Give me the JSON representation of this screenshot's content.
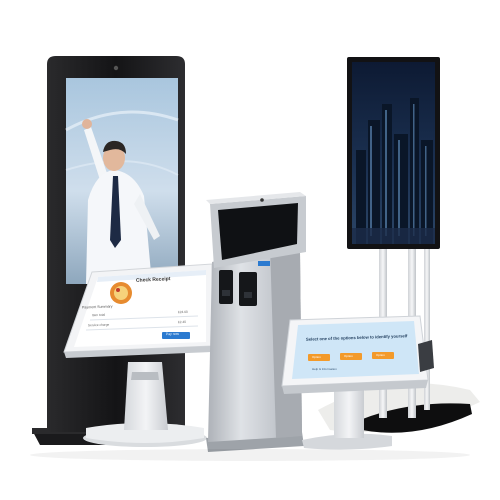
{
  "scene": {
    "background": "#ffffff",
    "products": [
      {
        "name": "tall-digital-signage-totem",
        "screen_content": "businessman-pointing-photo"
      },
      {
        "name": "ordering-tablet-kiosk"
      },
      {
        "name": "floor-standing-payment-kiosk"
      },
      {
        "name": "wall-display-on-pole-stand",
        "screen_content": "night-city-skyline-photo"
      },
      {
        "name": "countertop-tablet-kiosk"
      }
    ]
  },
  "tablet_kiosk_screen": {
    "title": "Check Receipt",
    "section_label": "Payment Summary",
    "rows": [
      {
        "label": "Item total",
        "value": "£24.00"
      },
      {
        "label": "Service charge",
        "value": "£2.40"
      }
    ],
    "button_label": "Pay now"
  },
  "counter_kiosk_screen": {
    "heading": "Select one of the options below to identify yourself",
    "options": [
      "Option",
      "Option",
      "Option"
    ],
    "footer_text": "Help & Information"
  },
  "colors": {
    "totem_frame": "#1f1f21",
    "kiosk_silver": "#c9ccd1",
    "tablet_white": "#f2f3f5",
    "screen_blue": "#cfe6f7",
    "accent_orange": "#f39a2a",
    "accent_blue": "#2b7ad0",
    "city_night": "#1a2740"
  }
}
